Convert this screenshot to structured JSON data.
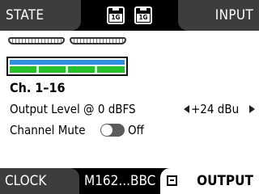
{
  "top_bar": {
    "left_tab": "STATE",
    "right_tab": "INPUT",
    "link_badges": [
      "1G",
      "1G"
    ]
  },
  "meter": {
    "colors": {
      "top": "#2e8ee0",
      "level": "#27c22b"
    }
  },
  "section": {
    "heading": "Ch. 1–16",
    "output_level_label": "Output Level @ 0 dBFS",
    "output_level_value": "+24 dBu",
    "channel_mute_label": "Channel Mute",
    "channel_mute_state": "Off"
  },
  "bottom_bar": {
    "left_tab": "CLOCK",
    "device_name": "M162...BBC",
    "active_tab": "OUTPUT"
  },
  "icons": {
    "connectors": "db25-connector-icon",
    "links": "network-link-icon",
    "collapse": "collapse-icon",
    "arrows": [
      "left-arrow-icon",
      "right-arrow-icon"
    ],
    "toggle": "toggle-switch"
  }
}
